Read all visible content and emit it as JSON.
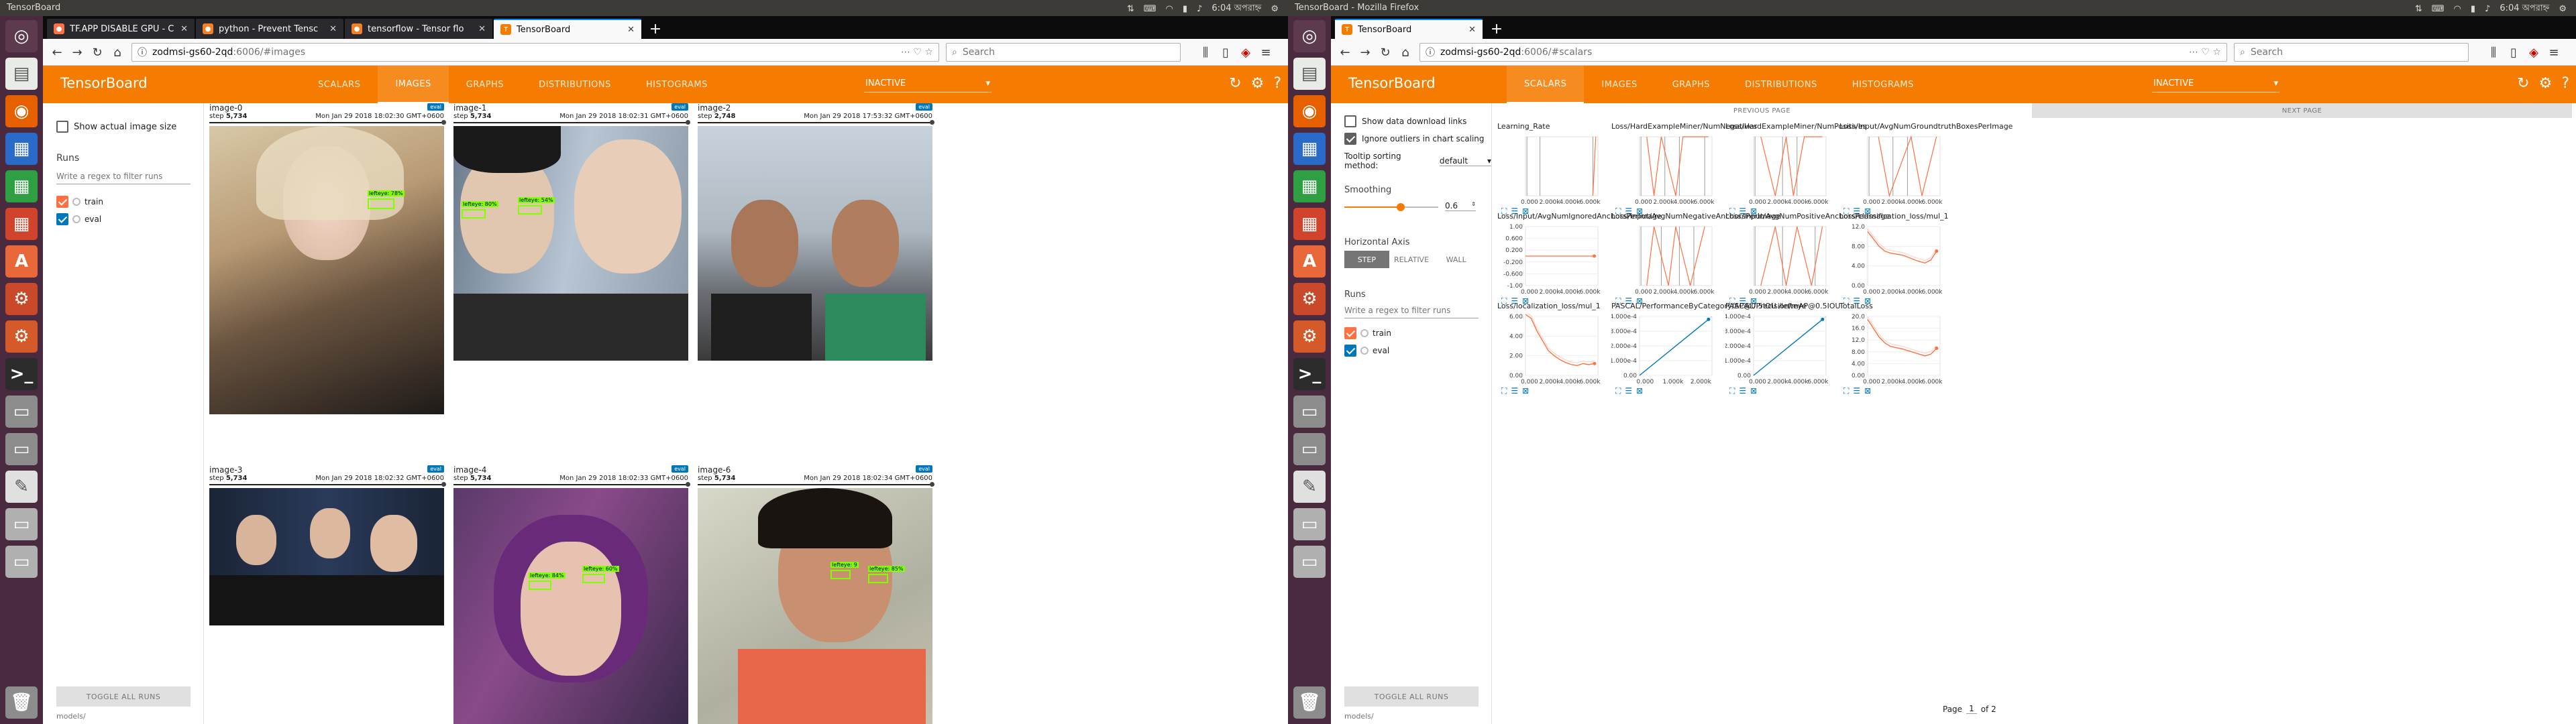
{
  "colors": {
    "accent": "#f57c00",
    "train": "#ff7043",
    "eval": "#0077bb",
    "launcher": "#4a2a3e",
    "topbar": "#3c3b37"
  },
  "left": {
    "window_title": "TensorBoard",
    "clock": "6:04 অপরাহ্ন",
    "tabs": [
      "TF.APP DISABLE GPU - C",
      "python - Prevent Tensc",
      "tensorflow - Tensor flo",
      "TensorBoard"
    ],
    "url_host": "zodmsi-gs60-2qd",
    "url_path": ":6006/#images",
    "search_placeholder": "Search",
    "app_title": "TensorBoard",
    "nav": [
      "SCALARS",
      "IMAGES",
      "GRAPHS",
      "DISTRIBUTIONS",
      "HISTOGRAMS"
    ],
    "dropdown": "INACTIVE",
    "show_actual": "Show actual image size",
    "runs_label": "Runs",
    "regex_placeholder": "Write a regex to filter runs",
    "runs": [
      "train",
      "eval"
    ],
    "toggle_all": "TOGGLE ALL RUNS",
    "logdir": "models/",
    "images": [
      {
        "tag": "image-0",
        "step_label": "step",
        "step": "5,734",
        "date": "Mon Jan 29 2018 18:02:30 GMT+0600",
        "badge": "eval",
        "dets": [
          "lefteye: 78%"
        ]
      },
      {
        "tag": "image-1",
        "step_label": "step",
        "step": "5,734",
        "date": "Mon Jan 29 2018 18:02:31 GMT+0600",
        "badge": "eval",
        "dets": [
          "lefteye: 80%",
          "lefteye: 54%"
        ]
      },
      {
        "tag": "image-2",
        "step_label": "step",
        "step": "2,748",
        "date": "Mon Jan 29 2018 17:53:32 GMT+0600",
        "badge": "eval",
        "dets": []
      },
      {
        "tag": "image-3",
        "step_label": "step",
        "step": "5,734",
        "date": "Mon Jan 29 2018 18:02:32 GMT+0600",
        "badge": "eval",
        "dets": []
      },
      {
        "tag": "image-4",
        "step_label": "step",
        "step": "5,734",
        "date": "Mon Jan 29 2018 18:02:33 GMT+0600",
        "badge": "eval",
        "dets": [
          "lefteye: 84%",
          "lefteye: 60%"
        ]
      },
      {
        "tag": "image-6",
        "step_label": "step",
        "step": "5,734",
        "date": "Mon Jan 29 2018 18:02:34 GMT+0600",
        "badge": "eval",
        "dets": [
          "lefteye: 9",
          "lefteye: 85%"
        ]
      }
    ]
  },
  "right": {
    "window_title": "TensorBoard - Mozilla Firefox",
    "clock": "6:04 অপরাহ্ন",
    "tabs": [
      "TensorBoard"
    ],
    "url_host": "zodmsi-gs60-2qd",
    "url_path": ":6006/#scalars",
    "search_placeholder": "Search",
    "app_title": "TensorBoard",
    "nav": [
      "SCALARS",
      "IMAGES",
      "GRAPHS",
      "DISTRIBUTIONS",
      "HISTOGRAMS"
    ],
    "dropdown": "INACTIVE",
    "show_download": "Show data download links",
    "ignore_outliers": "Ignore outliers in chart scaling",
    "tooltip_label": "Tooltip sorting method:",
    "tooltip_value": "default",
    "smoothing_label": "Smoothing",
    "smoothing_value": "0.6",
    "smoothing_fraction": 0.6,
    "haxis_label": "Horizontal Axis",
    "haxis_options": [
      "STEP",
      "RELATIVE",
      "WALL"
    ],
    "runs_label": "Runs",
    "regex_placeholder": "Write a regex to filter runs",
    "runs": [
      "train",
      "eval"
    ],
    "toggle_all": "TOGGLE ALL RUNS",
    "logdir": "models/",
    "prev_page": "PREVIOUS PAGE",
    "next_page": "NEXT PAGE",
    "page_prefix": "Page",
    "page_value": "1",
    "page_suffix": "of 2"
  },
  "chart_data": [
    {
      "type": "line",
      "title": "Learning_Rate",
      "x": [
        0,
        5600,
        6000
      ],
      "series": [],
      "xlim": [
        0,
        6200
      ],
      "xticks": [
        "0.000",
        "2.000k",
        "4.000k",
        "6.000k"
      ]
    },
    {
      "type": "line",
      "title": "Loss/HardExampleMiner/NumNegatives",
      "xlim": [
        0,
        6200
      ],
      "xticks": [
        "0.000",
        "2.000k",
        "4.000k",
        "6.000k"
      ]
    },
    {
      "type": "line",
      "title": "Loss/HardExampleMiner/NumPositives",
      "xlim": [
        0,
        6200
      ],
      "xticks": [
        "0.000",
        "2.000k",
        "4.000k",
        "6.000k"
      ]
    },
    {
      "type": "line",
      "title": "Loss/Input/AvgNumGroundtruthBoxesPerImage",
      "xlim": [
        0,
        6200
      ],
      "xticks": [
        "0.000",
        "2.000k",
        "4.000k",
        "6.000k"
      ]
    },
    {
      "type": "line",
      "title": "Loss/Input/AvgNumIgnoredAnchorsPerImage",
      "yticks": [
        "1.00",
        "0.600",
        "0.200",
        "-0.200",
        "-0.600",
        "-1.00"
      ],
      "xticks": [
        "0.000",
        "2.000k",
        "4.000k",
        "6.000k"
      ],
      "x": [
        0,
        6000
      ],
      "y": [
        0,
        0
      ]
    },
    {
      "type": "line",
      "title": "Loss/Input/AvgNumNegativeAnchorsPerImage",
      "xticks": [
        "0.000",
        "2.000k",
        "4.000k",
        "6.000k"
      ]
    },
    {
      "type": "line",
      "title": "Loss/Input/AvgNumPositiveAnchorsPerImage",
      "xticks": [
        "0.000",
        "2.000k",
        "4.000k",
        "6.000k"
      ]
    },
    {
      "type": "line",
      "title": "Loss/classification_loss/mul_1",
      "yticks": [
        "12.0",
        "8.00",
        "4.00",
        "0.00"
      ],
      "xticks": [
        "0.000",
        "2.000k",
        "4.000k",
        "6.000k"
      ],
      "x": [
        0,
        500,
        1000,
        1500,
        2000,
        2500,
        3000,
        3500,
        4000,
        4500,
        5000,
        5500,
        6000
      ],
      "y": [
        11,
        9.5,
        8,
        7,
        6.6,
        6.4,
        6.2,
        5.8,
        5.3,
        4.9,
        4.6,
        5.2,
        7
      ]
    },
    {
      "type": "line",
      "title": "Loss/localization_loss/mul_1",
      "yticks": [
        "6.00",
        "4.00",
        "2.00",
        "0.00"
      ],
      "xticks": [
        "0.000",
        "2.000k",
        "4.000k",
        "6.000k"
      ],
      "x": [
        0,
        500,
        1000,
        1500,
        2000,
        2500,
        3000,
        3500,
        4000,
        4500,
        5000,
        5500,
        6000
      ],
      "y": [
        6.2,
        5.8,
        4.5,
        3.5,
        2.5,
        2.0,
        1.6,
        1.3,
        1.1,
        1.0,
        1.2,
        1.1,
        1.2
      ]
    },
    {
      "type": "line",
      "title": "PASCAL/PerformanceByCategory/AP@0.5IOU /lefteye",
      "yticks": [
        "4.000e-4",
        "3.000e-4",
        "2.000e-4",
        "1.000e-4",
        "0.00"
      ],
      "xticks": [
        "0.000",
        "1.000k",
        "2.000k"
      ],
      "x": [
        0,
        2700
      ],
      "y": [
        0,
        0.00038
      ]
    },
    {
      "type": "line",
      "title": "PASCAL/Precision/mAP@0.5IOU",
      "yticks": [
        "4.000e-4",
        "3.000e-4",
        "2.000e-4",
        "1.000e-4",
        "0.00"
      ],
      "xticks": [
        "0.000",
        "2.000k",
        "4.000k",
        "6.000k"
      ],
      "x": [
        0,
        5700
      ],
      "y": [
        0,
        0.00038
      ]
    },
    {
      "type": "line",
      "title": "TotalLoss",
      "yticks": [
        "20.0",
        "16.0",
        "12.0",
        "8.00",
        "4.00",
        "0.00"
      ],
      "xticks": [
        "0.000",
        "2.000k",
        "4.000k",
        "6.000k"
      ],
      "x": [
        0,
        500,
        1000,
        1500,
        2000,
        2500,
        3000,
        3500,
        4000,
        4500,
        5000,
        5500,
        6000
      ],
      "y": [
        19,
        16,
        13,
        11,
        9.8,
        9.4,
        9,
        8.4,
        7.8,
        7.2,
        6.6,
        7.2,
        9.2
      ]
    }
  ]
}
